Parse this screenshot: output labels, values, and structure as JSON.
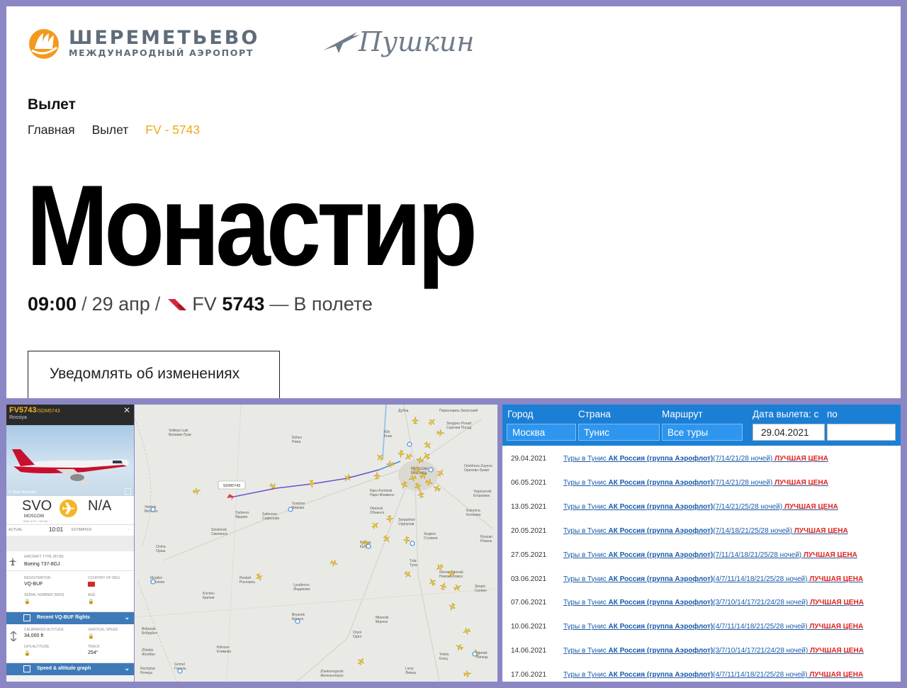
{
  "header": {
    "airport_name": "ШЕРЕМЕТЬЕВО",
    "airport_sub": "МЕЖДУНАРОДНЫЙ АЭРОПОРТ",
    "pushkin_word": "Пушкин"
  },
  "page": {
    "section_title": "Вылет",
    "breadcrumb": [
      "Главная",
      "Вылет",
      "FV - 5743"
    ],
    "city": "Монастир",
    "time": "09:00",
    "date": "29 апр",
    "flight_prefix": "FV",
    "flight_number": "5743",
    "status": "В полете",
    "notify_label": "Уведомлять об изменениях",
    "accent_color": "#f0a81c"
  },
  "tracker": {
    "callsign": "FV5743",
    "alt_callsign": "/SDM5743",
    "airline": "Rossiya",
    "photo_credit": "© Vitaly Revyakin",
    "origin_code": "SVO",
    "origin_city": "MOSCOW",
    "origin_tz": "MSK (UTC +03:00)",
    "dest_code": "N/A",
    "actual_label": "ACTUAL",
    "actual_time": "10:01",
    "estimated_label": "ESTIMATED",
    "estimated_value": "-",
    "aircraft_type_label": "AIRCRAFT TYPE",
    "aircraft_type_code": "(B738)",
    "aircraft_type": "Boeing 737-8GJ",
    "registration_label": "REGISTRATION",
    "registration": "VQ-BUF",
    "country_label": "COUNTRY OF REG.",
    "serial_label": "SERIAL NUMBER (MSN)",
    "age_label": "AGE",
    "recent_flights_label": "Recent VQ-BUF flights",
    "cal_alt_label": "CALIBRATED ALTITUDE",
    "cal_alt": "34,000 ft",
    "vert_speed_label": "VERTICAL SPEED",
    "gps_alt_label": "GPS ALTITUDE",
    "track_label": "TRACK",
    "track": "254°",
    "graph_label": "Speed & altitude graph",
    "brand_yellow": "#f5b523",
    "bar_blue": "#3f7ab8"
  },
  "map": {
    "flight_tag": "SDM5743",
    "places": [
      {
        "n": "Дубна"
      },
      {
        "n": "Переславль-Залесский"
      },
      {
        "n": "Sergiyev Posad",
        "r": "Сергиев Посад"
      },
      {
        "n": "Klin",
        "r": "Клин"
      },
      {
        "n": "Moscow",
        "r": "Москва"
      },
      {
        "n": "Orekhovo-Zuyevo",
        "r": "Орехово-Зуево"
      },
      {
        "n": "Yegoryevsk",
        "r": "Егорьевск"
      },
      {
        "n": "Kolomna",
        "r": "Коломна"
      },
      {
        "n": "Naro-Fominsk",
        "r": "Наро-Фоминск"
      },
      {
        "n": "Obninsk",
        "r": "Обнинск"
      },
      {
        "n": "Serpukhov",
        "r": "Серпухов"
      },
      {
        "n": "Stupino",
        "r": "Ступино"
      },
      {
        "n": "Ryazan",
        "r": "Рязань"
      },
      {
        "n": "Velikiye Luki",
        "r": "Великие Луки"
      },
      {
        "n": "Vitebsk",
        "r": "Витебск"
      },
      {
        "n": "Rzhev",
        "r": "Ржев"
      },
      {
        "n": "Vyazma",
        "r": "Вязьма"
      },
      {
        "n": "Yartsevo",
        "r": "Ярцево"
      },
      {
        "n": "Safonovo",
        "r": "Сафоново"
      },
      {
        "n": "Smolensk",
        "r": "Смоленск"
      },
      {
        "n": "Orsha",
        "r": "Орша"
      },
      {
        "n": "Kaluga",
        "r": "Калуга"
      },
      {
        "n": "Tula",
        "r": "Тула"
      },
      {
        "n": "Novomoskovsk",
        "r": "Новомосковск"
      },
      {
        "n": "Skopin",
        "r": "Скопин"
      },
      {
        "n": "Mogilev",
        "r": "Могилев"
      },
      {
        "n": "Roslavl",
        "r": "Рославль"
      },
      {
        "n": "Lyudinovo",
        "r": "Людиново"
      },
      {
        "n": "Bryansk",
        "r": "Брянск"
      },
      {
        "n": "Oryol",
        "r": "Орёл"
      },
      {
        "n": "Yelets",
        "r": "Елец"
      },
      {
        "n": "Lipetsk",
        "r": "Липецк"
      },
      {
        "n": "Gomel",
        "r": "Гомель"
      },
      {
        "n": "Zhlobin",
        "r": "Жлобин"
      },
      {
        "n": "Rechytsa",
        "r": "Речица"
      },
      {
        "n": "Zheleznogorsk",
        "r": "Железногорск"
      },
      {
        "n": "Livny",
        "r": "Ливны"
      },
      {
        "n": "Mtsensk",
        "r": "Мценск"
      },
      {
        "n": "Bobruisk",
        "r": "Бобруйск"
      },
      {
        "n": "Krichev",
        "r": "Кричев"
      },
      {
        "n": "Klimovo",
        "r": "Климово"
      }
    ]
  },
  "tours": {
    "headers": {
      "city": "Город",
      "country": "Страна",
      "route": "Маршрут",
      "date_from": "Дата вылета: с",
      "date_to": "по"
    },
    "selects": {
      "city": "Москва",
      "country": "Тунис",
      "route": "Все туры",
      "date_from": "29.04.2021",
      "date_to": ""
    },
    "rows": [
      {
        "date": "29.04.2021",
        "pre": "Туры в Тунис ",
        "airline": "АК Россия (группа Аэрофлот)",
        "nights": "(7/14/21/28 ночей)",
        "best": "ЛУЧШАЯ ЦЕНА"
      },
      {
        "date": "06.05.2021",
        "pre": "Туры в Тунис ",
        "airline": "АК Россия (группа Аэрофлот)",
        "nights": "(7/14/21/28 ночей)",
        "best": "ЛУЧШАЯ ЦЕНА"
      },
      {
        "date": "13.05.2021",
        "pre": "Туры в Тунис ",
        "airline": "АК Россия (группа Аэрофлот)",
        "nights": "(7/14/21/25/28 ночей)",
        "best": "ЛУЧШАЯ ЦЕНА"
      },
      {
        "date": "20.05.2021",
        "pre": "Туры в Тунис ",
        "airline": "АК Россия (группа Аэрофлот)",
        "nights": "(7/14/18/21/25/28 ночей)",
        "best": "ЛУЧШАЯ ЦЕНА"
      },
      {
        "date": "27.05.2021",
        "pre": "Туры в Тунис ",
        "airline": "АК Россия (группа Аэрофлот)",
        "nights": "(7/11/14/18/21/25/28 ночей)",
        "best": "ЛУЧШАЯ ЦЕНА"
      },
      {
        "date": "03.06.2021",
        "pre": "Туры в Тунис ",
        "airline": "АК Россия (группа Аэрофлот)",
        "nights": "(4/7/11/14/18/21/25/28 ночей)",
        "best": "ЛУЧШАЯ ЦЕНА"
      },
      {
        "date": "07.06.2021",
        "pre": "Туры в Тунис ",
        "airline": "АК Россия (группа Аэрофлот)",
        "nights": "(3/7/10/14/17/21/24/28 ночей)",
        "best": "ЛУЧШАЯ ЦЕНА"
      },
      {
        "date": "10.06.2021",
        "pre": "Туры в Тунис ",
        "airline": "АК Россия (группа Аэрофлот)",
        "nights": "(4/7/11/14/18/21/25/28 ночей)",
        "best": "ЛУЧШАЯ ЦЕНА"
      },
      {
        "date": "14.06.2021",
        "pre": "Туры в Тунис ",
        "airline": "АК Россия (группа Аэрофлот)",
        "nights": "(3/7/10/14/17/21/24/28 ночей)",
        "best": "ЛУЧШАЯ ЦЕНА"
      },
      {
        "date": "17.06.2021",
        "pre": "Туры в Тунис ",
        "airline": "АК Россия (группа Аэрофлот)",
        "nights": "(4/7/11/14/18/21/25/28 ночей)",
        "best": "ЛУЧШАЯ ЦЕНА"
      }
    ],
    "header_blue": "#1c7fd6",
    "best_red": "#e0231c"
  }
}
